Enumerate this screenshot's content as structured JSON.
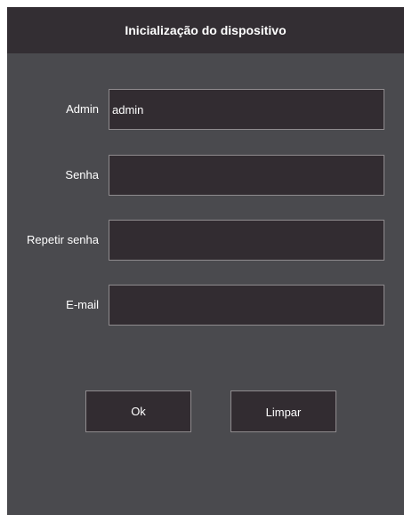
{
  "dialog": {
    "title": "Inicialização do dispositivo"
  },
  "form": {
    "fields": [
      {
        "label": "Admin",
        "value": "admin",
        "placeholder": ""
      },
      {
        "label": "Senha",
        "value": "",
        "placeholder": ""
      },
      {
        "label": "Repetir senha",
        "value": "",
        "placeholder": ""
      },
      {
        "label": "E-mail",
        "value": "",
        "placeholder": ""
      }
    ]
  },
  "buttons": {
    "ok_label": "Ok",
    "clear_label": "Limpar"
  },
  "colors": {
    "background": "#4a4a4e",
    "titlebar": "#332e33",
    "field_background": "#322c31",
    "field_border": "#8f8b8e",
    "text": "#ffffff"
  }
}
